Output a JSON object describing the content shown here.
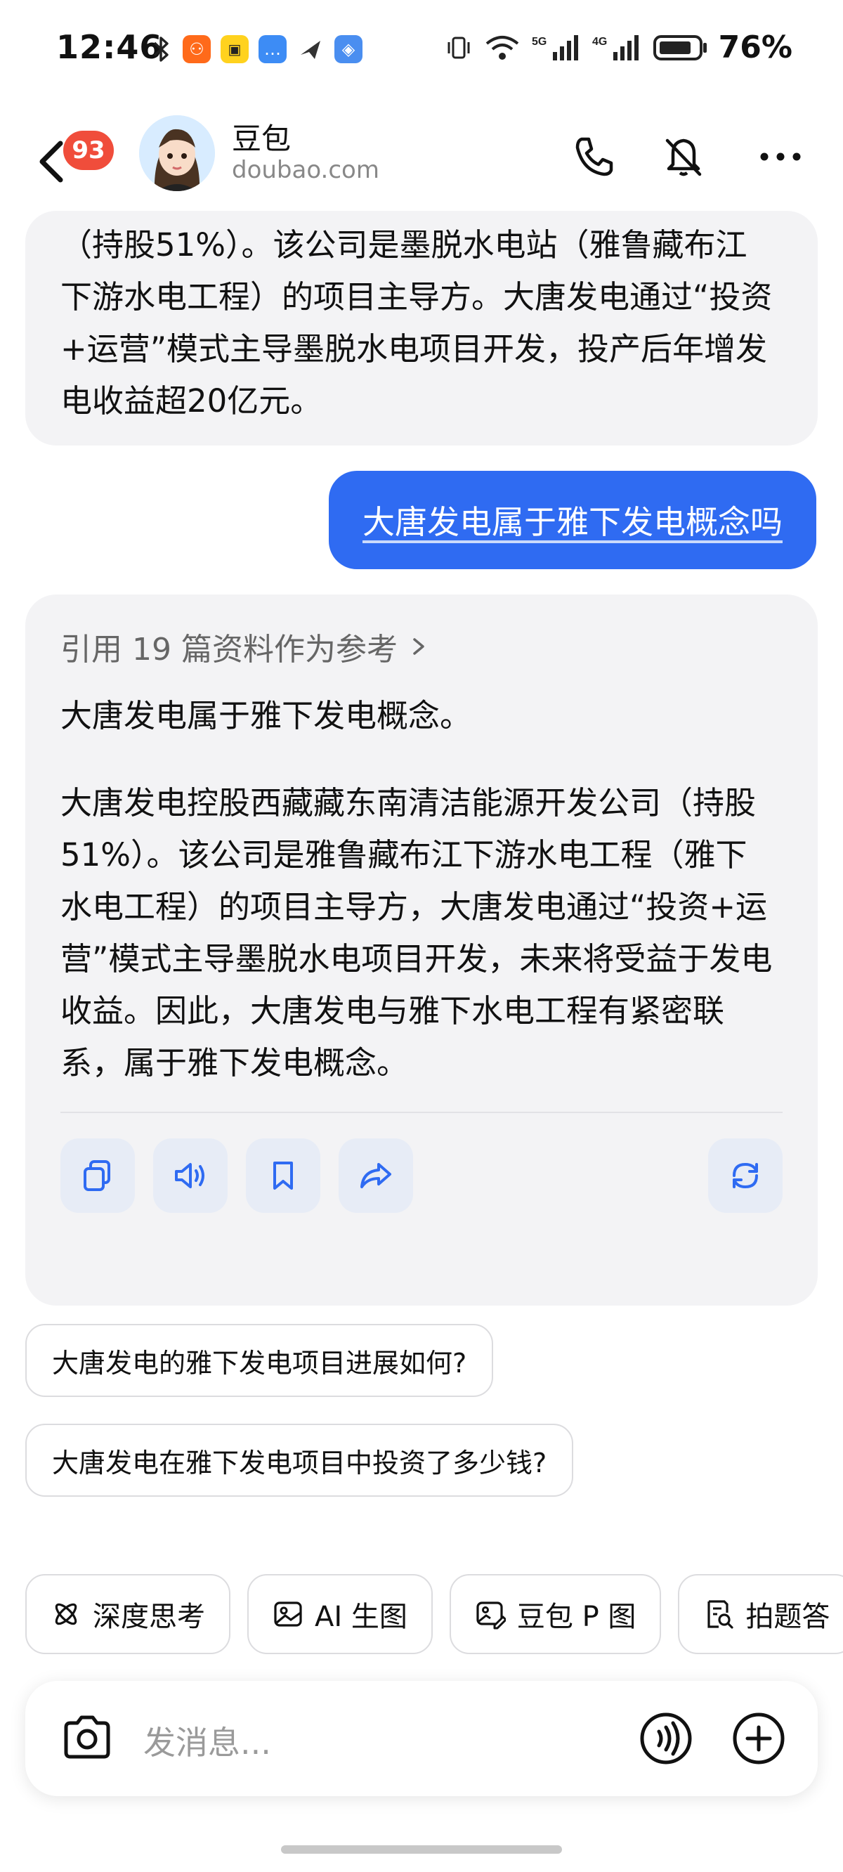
{
  "status_bar": {
    "time": "12:46",
    "battery_percent": "76%",
    "signal_labels": [
      "5G",
      "4G"
    ]
  },
  "header": {
    "unread_badge": "93",
    "bot_name": "豆包",
    "bot_domain": "doubao.com"
  },
  "chat": {
    "prev_bot_message": "（持股51%）。该公司是墨脱水电站（雅鲁藏布江下游水电工程）的项目主导方。大唐发电通过“投资+运营”模式主导墨脱水电项目开发，投产后年增发电收益超20亿元。",
    "user_message": "大唐发电属于雅下发电概念吗",
    "reference_label": "引用 19 篇资料作为参考",
    "answer_summary": "大唐发电属于雅下发电概念。",
    "answer_detail": "大唐发电控股西藏藏东南清洁能源开发公司（持股51%）。该公司是雅鲁藏布江下游水电工程（雅下水电工程）的项目主导方，大唐发电通过“投资+运营”模式主导墨脱水电项目开发，未来将受益于发电收益。因此，大唐发电与雅下水电工程有紧密联系，属于雅下发电概念。"
  },
  "suggestions": [
    "大唐发电的雅下发电项目进展如何?",
    "大唐发电在雅下发电项目中投资了多少钱?"
  ],
  "tools": [
    {
      "label": "深度思考",
      "icon": "atom-icon"
    },
    {
      "label": "AI 生图",
      "icon": "image-icon"
    },
    {
      "label": "豆包 P 图",
      "icon": "photo-edit-icon"
    },
    {
      "label": "拍题答",
      "icon": "doc-search-icon"
    }
  ],
  "input": {
    "placeholder": "发消息..."
  },
  "colors": {
    "accent": "#2f6bf2",
    "badge": "#f04d3b",
    "bubble_bg": "#f3f3f5"
  }
}
